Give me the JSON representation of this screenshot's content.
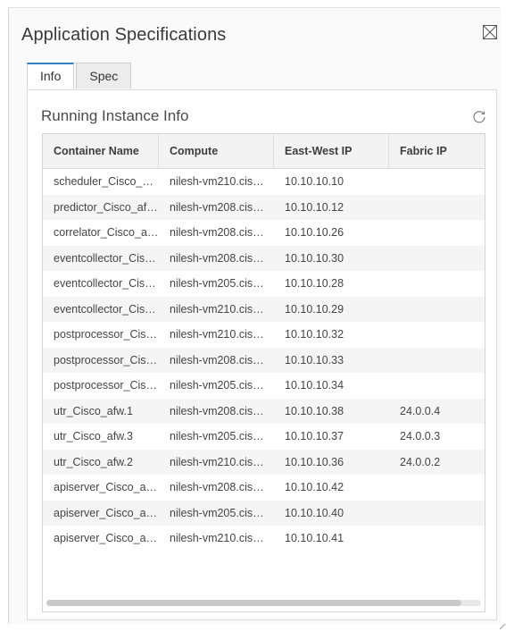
{
  "dialog": {
    "title": "Application Specifications",
    "close_icon": "close-box-icon"
  },
  "tabs": [
    {
      "label": "Info",
      "active": true
    },
    {
      "label": "Spec",
      "active": false
    }
  ],
  "section": {
    "title": "Running Instance Info",
    "refresh_icon": "refresh-icon"
  },
  "table": {
    "columns": [
      "Container Name",
      "Compute",
      "East-West IP",
      "Fabric IP"
    ],
    "rows": [
      [
        "scheduler_Cisco_…",
        "nilesh-vm210.cis…",
        "10.10.10.10",
        ""
      ],
      [
        "predictor_Cisco_af…",
        "nilesh-vm208.cis…",
        "10.10.10.12",
        ""
      ],
      [
        "correlator_Cisco_a…",
        "nilesh-vm208.cis…",
        "10.10.10.26",
        ""
      ],
      [
        "eventcollector_Cis…",
        "nilesh-vm208.cis…",
        "10.10.10.30",
        ""
      ],
      [
        "eventcollector_Cis…",
        "nilesh-vm205.cis…",
        "10.10.10.28",
        ""
      ],
      [
        "eventcollector_Cis…",
        "nilesh-vm210.cis…",
        "10.10.10.29",
        ""
      ],
      [
        "postprocessor_Cis…",
        "nilesh-vm210.cis…",
        "10.10.10.32",
        ""
      ],
      [
        "postprocessor_Cis…",
        "nilesh-vm208.cis…",
        "10.10.10.33",
        ""
      ],
      [
        "postprocessor_Cis…",
        "nilesh-vm205.cis…",
        "10.10.10.34",
        ""
      ],
      [
        "utr_Cisco_afw.1",
        "nilesh-vm208.cis…",
        "10.10.10.38",
        "24.0.0.4"
      ],
      [
        "utr_Cisco_afw.3",
        "nilesh-vm205.cis…",
        "10.10.10.37",
        "24.0.0.3"
      ],
      [
        "utr_Cisco_afw.2",
        "nilesh-vm210.cis…",
        "10.10.10.36",
        "24.0.0.2"
      ],
      [
        "apiserver_Cisco_a…",
        "nilesh-vm208.cis…",
        "10.10.10.42",
        ""
      ],
      [
        "apiserver_Cisco_a…",
        "nilesh-vm205.cis…",
        "10.10.10.40",
        ""
      ],
      [
        "apiserver_Cisco_a…",
        "nilesh-vm210.cis…",
        "10.10.10.41",
        ""
      ]
    ]
  },
  "colors": {
    "accent": "#2f7fc1",
    "header_bg": "#f3f3f3",
    "stripe_bg": "#f5f5f5"
  }
}
